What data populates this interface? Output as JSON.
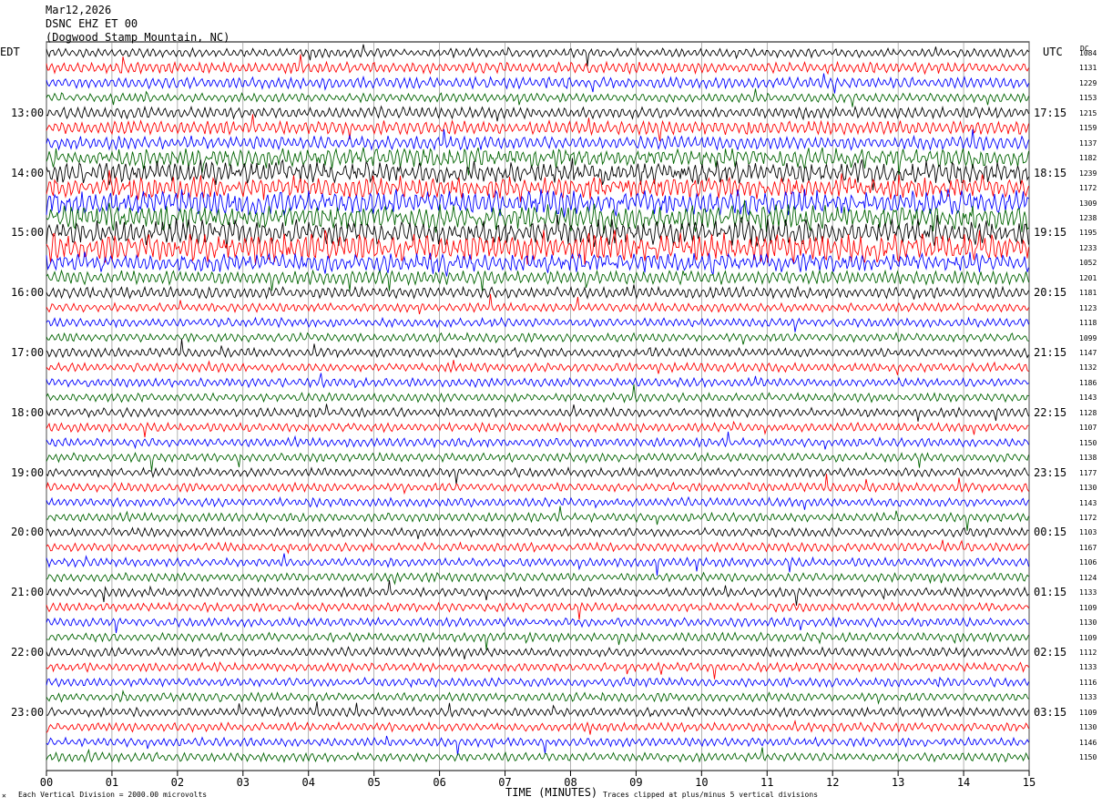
{
  "header": {
    "date": "Mar12,2026",
    "station": "DSNC EHZ ET 00",
    "location": "(Dogwood Stamp Mountain, NC)"
  },
  "left_axis_title": "EDT",
  "right_axis_title": "UTC",
  "dc_title": "DC",
  "left_hour_labels": [
    "13:00",
    "14:00",
    "15:00",
    "16:00",
    "17:00",
    "18:00",
    "19:00",
    "20:00",
    "21:00",
    "22:00",
    "23:00"
  ],
  "right_hour_labels": [
    "17:15",
    "18:15",
    "19:15",
    "20:15",
    "21:15",
    "22:15",
    "23:15",
    "00:15",
    "01:15",
    "02:15",
    "03:15"
  ],
  "footer": {
    "scale_note": "Each Vertical Division = 2000.00 microvolts",
    "x_title": "TIME (MINUTES)",
    "clip_note": "Traces clipped at plus/minus 5 vertical divisions"
  },
  "colors": {
    "cycle": [
      "#000000",
      "#ff0000",
      "#0000ff",
      "#006400"
    ],
    "grid": "#808080"
  },
  "chart_data": {
    "type": "line",
    "title": "DSNC EHZ ET 00 (Dogwood Stamp Mountain, NC) Mar12,2026",
    "xlabel": "TIME (MINUTES)",
    "x_ticks": [
      "00",
      "01",
      "02",
      "03",
      "04",
      "05",
      "06",
      "07",
      "08",
      "09",
      "10",
      "11",
      "12",
      "13",
      "14",
      "15"
    ],
    "xlim": [
      0,
      15
    ],
    "trace_minutes": 15,
    "trace_count": 48,
    "first_trace_start_edt": "12:00",
    "dc_offsets": [
      1084,
      1131,
      1229,
      1153,
      1215,
      1159,
      1137,
      1182,
      1239,
      1172,
      1309,
      1238,
      1195,
      1233,
      1052,
      1201,
      1181,
      1123,
      1118,
      1099,
      1147,
      1132,
      1186,
      1143,
      1128,
      1107,
      1150,
      1138,
      1177,
      1130,
      1143,
      1172,
      1103,
      1167,
      1106,
      1124,
      1133,
      1109,
      1130,
      1109,
      1112,
      1133,
      1116,
      1133,
      1109,
      1130,
      1146,
      1150
    ],
    "relative_noise_level": [
      2,
      3,
      3,
      2,
      3,
      4,
      4,
      5,
      6,
      6,
      7,
      7,
      7,
      8,
      5,
      4,
      3,
      2,
      2,
      2,
      2,
      2,
      2,
      2,
      2,
      2,
      2,
      2,
      2,
      2,
      2,
      2,
      2,
      2,
      2,
      2,
      2,
      2,
      2,
      2,
      2,
      2,
      2,
      2,
      2,
      2,
      2,
      2
    ],
    "clip_divisions": 5,
    "microvolts_per_division": 2000
  }
}
